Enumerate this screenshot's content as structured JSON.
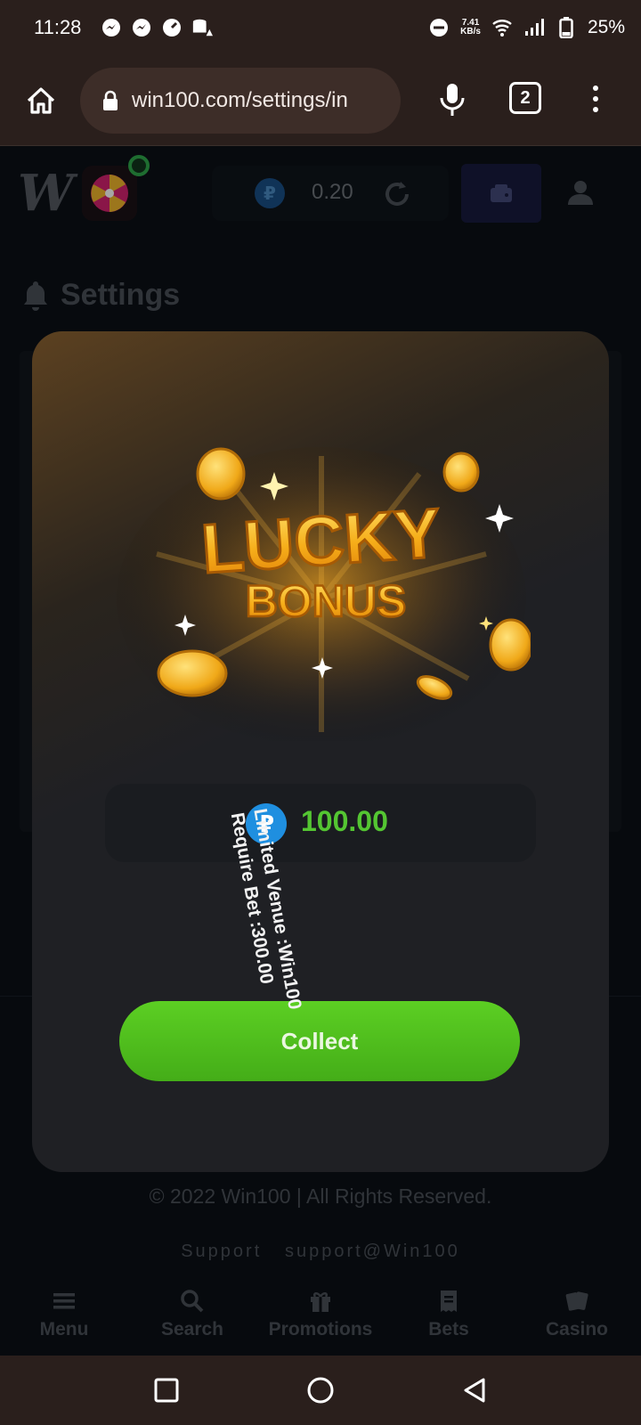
{
  "status_bar": {
    "time": "11:28",
    "net_speed_value": "7.41",
    "net_speed_unit": "KB/s",
    "battery": "25%"
  },
  "browser": {
    "url": "win100.com/settings/in",
    "tab_count": "2"
  },
  "site_header": {
    "logo": "W",
    "balance": "0.20"
  },
  "page": {
    "title": "Settings",
    "footer_copyright": "© 2022 Win100 | All Rights Reserved.",
    "footer_support_label": "Support",
    "footer_support_email": "support@Win100"
  },
  "modal": {
    "hero_title_line1": "LUCKY",
    "hero_title_line2": "BONUS",
    "amount": "100.00",
    "currency_symbol": "₽",
    "rotated_line1": "Limited Venue :Win100",
    "rotated_line2": "Require Bet :300.00",
    "collect_label": "Collect"
  },
  "bottom_nav": {
    "items": [
      {
        "label": "Menu",
        "icon": "menu-icon"
      },
      {
        "label": "Search",
        "icon": "search-icon"
      },
      {
        "label": "Promotions",
        "icon": "gift-icon"
      },
      {
        "label": "Bets",
        "icon": "receipt-icon"
      },
      {
        "label": "Casino",
        "icon": "cards-icon"
      }
    ]
  },
  "colors": {
    "accent_green": "#54c632",
    "button_green": "#4cbb1c",
    "coin_blue": "#1f8fe0",
    "gold": "#f5b21c"
  }
}
